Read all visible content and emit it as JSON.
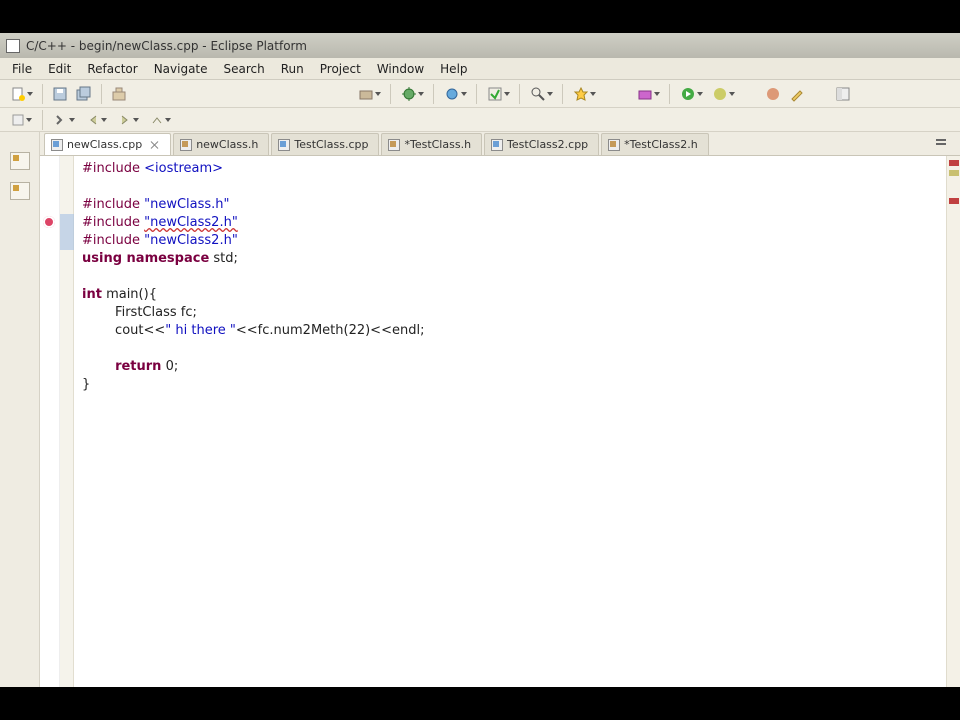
{
  "window": {
    "title": "C/C++ - begin/newClass.cpp - Eclipse Platform"
  },
  "menu": {
    "items": [
      "File",
      "Edit",
      "Refactor",
      "Navigate",
      "Search",
      "Run",
      "Project",
      "Window",
      "Help"
    ]
  },
  "tabs": [
    {
      "label": "newClass.cpp",
      "kind": "cpp",
      "active": true,
      "closeable": true
    },
    {
      "label": "newClass.h",
      "kind": "h",
      "active": false,
      "closeable": false
    },
    {
      "label": "TestClass.cpp",
      "kind": "cpp",
      "active": false,
      "closeable": false
    },
    {
      "label": "*TestClass.h",
      "kind": "h",
      "active": false,
      "closeable": false
    },
    {
      "label": "TestClass2.cpp",
      "kind": "cpp",
      "active": false,
      "closeable": false
    },
    {
      "label": "*TestClass2.h",
      "kind": "h",
      "active": false,
      "closeable": false
    }
  ],
  "code": {
    "l1_a": "#include ",
    "l1_b": "<iostream>",
    "l2": "",
    "l3_a": "#include ",
    "l3_b": "\"newClass.h\"",
    "l4_a": "#include ",
    "l4_b": "\"newClass2.h\"",
    "l5_a": "#include ",
    "l5_b": "\"newClass2.h\"",
    "l6_a": "using",
    "l6_b": " namespace",
    "l6_c": " std;",
    "l7": "",
    "l8_a": "int",
    "l8_b": " main(){",
    "l9": "        FirstClass fc;",
    "l10_a": "        cout<<",
    "l10_b": "\" hi there \"",
    "l10_c": "<<fc.num2Meth(22)<<endl;",
    "l11": "",
    "l12_a": "        ",
    "l12_b": "return",
    "l12_c": " 0;",
    "l13": "}"
  }
}
